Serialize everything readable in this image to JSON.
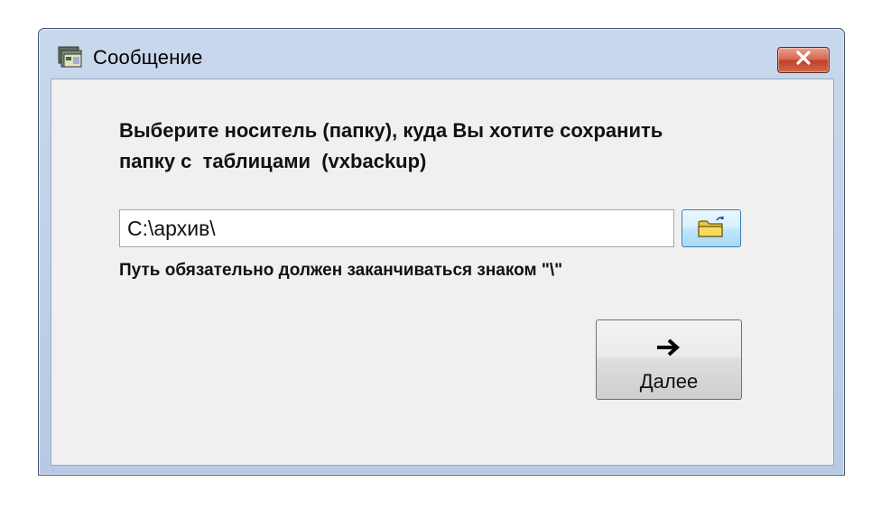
{
  "window": {
    "title": "Сообщение",
    "title_icon": "app-window-icon",
    "close_icon": "close-x-icon"
  },
  "message": {
    "line1": "Выберите носитель (папку), куда Вы хотите сохранить",
    "line2": "папку с  таблицами  (vxbackup)"
  },
  "path_field": {
    "value": "C:\\архив\\"
  },
  "browse_button": {
    "icon": "folder-open-icon"
  },
  "hint": {
    "text": "Путь обязательно должен заканчиваться знаком \"\\\""
  },
  "next_button": {
    "label": "Далее",
    "icon": "arrow-right-icon"
  },
  "colors": {
    "frame": "#bed0e8",
    "client": "#f0f0f0",
    "close_button": "#c2402a",
    "browse_button_border": "#3c7fb1"
  }
}
